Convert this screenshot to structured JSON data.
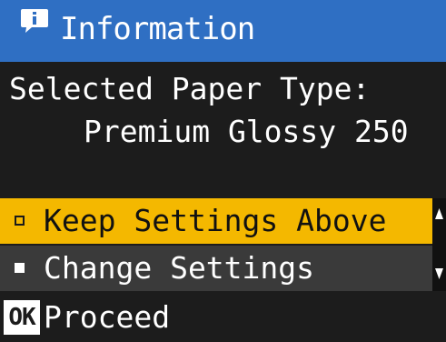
{
  "header": {
    "title": "Information",
    "icon": "info-icon",
    "color": "#2f6fc3"
  },
  "body": {
    "label": "Selected Paper Type:",
    "value": "Premium Glossy 250"
  },
  "options": [
    {
      "label": "Keep Settings Above",
      "selected": true
    },
    {
      "label": "Change Settings",
      "selected": false
    }
  ],
  "footer": {
    "button_label": "OK",
    "action_label": "Proceed"
  },
  "colors": {
    "selected_highlight": "#f4b800",
    "background": "#1c1c1c",
    "unselected_row": "#3a3a3a"
  }
}
